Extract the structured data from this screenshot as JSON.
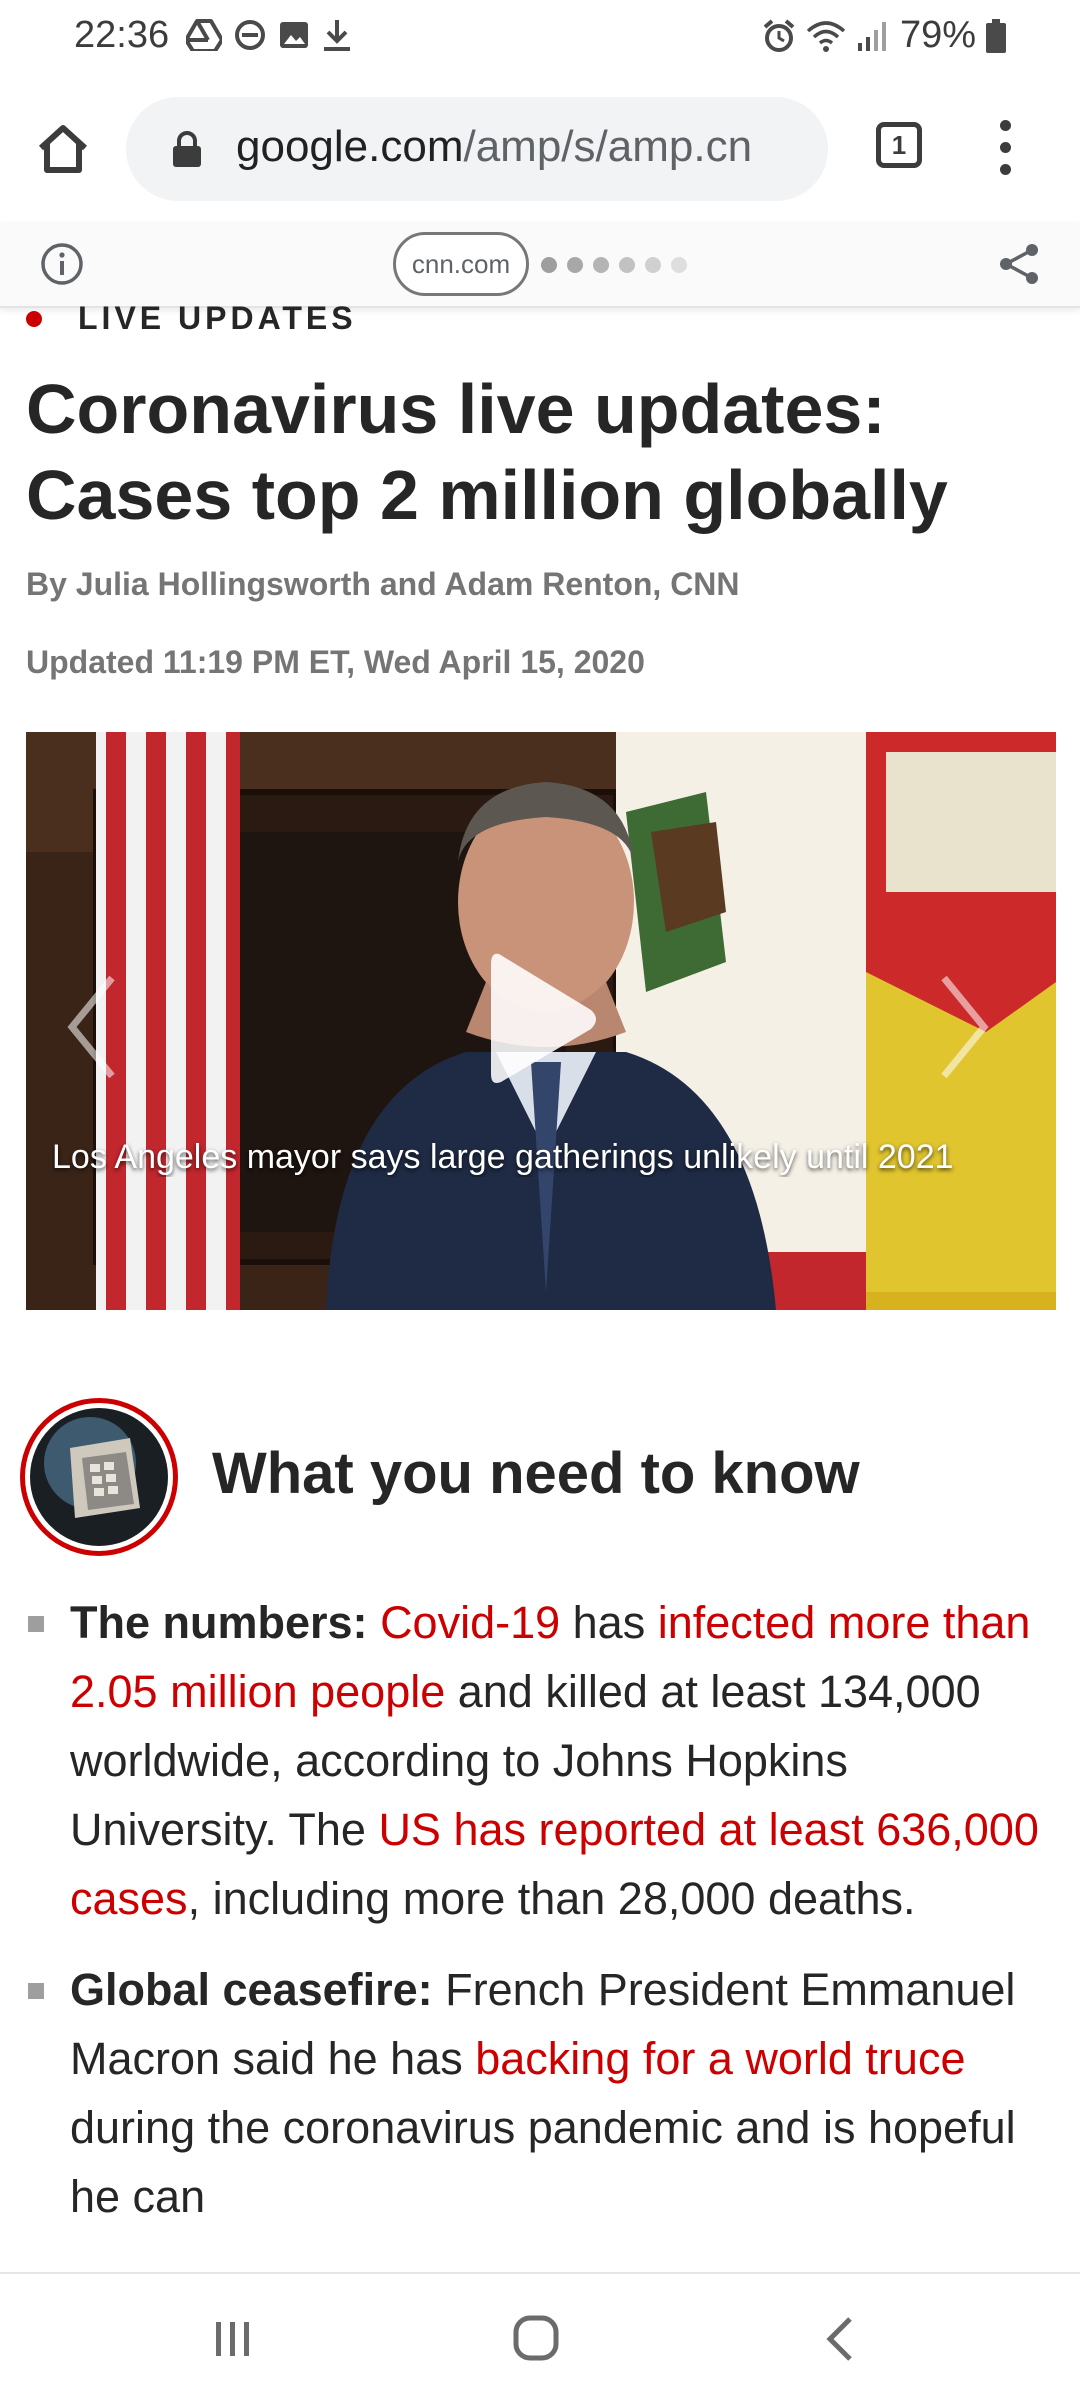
{
  "status_bar": {
    "time": "22:36",
    "left_icons": [
      "drive-icon",
      "do-not-disturb-icon",
      "gallery-icon",
      "download-icon"
    ],
    "right_icons": [
      "alarm-icon",
      "wifi-icon",
      "signal-icon"
    ],
    "battery_text": "79%"
  },
  "browser": {
    "url_domain": "google.com",
    "url_path": "/amp/s/amp.cn",
    "tab_count": "1"
  },
  "amp_header": {
    "source": "cnn.com"
  },
  "article": {
    "live_label": "LIVE UPDATES",
    "headline": "Coronavirus live updates: Cases top 2 million globally",
    "byline": "By Julia Hollingsworth and Adam Renton, CNN",
    "updated": "Updated 11:19 PM ET, Wed April 15, 2020",
    "video_caption": "Los Angeles mayor says large gatherings unlikely until 2021"
  },
  "section": {
    "title": "What you need to know"
  },
  "bullets": [
    {
      "label": "The numbers:",
      "parts": [
        {
          "text": " ",
          "link": false
        },
        {
          "text": "Covid-19",
          "link": true
        },
        {
          "text": " has ",
          "link": false
        },
        {
          "text": "infected more than 2.05 million people",
          "link": true
        },
        {
          "text": " and killed at least 134,000 worldwide, according to Johns Hopkins University. The ",
          "link": false
        },
        {
          "text": "US has reported at least 636,000 cases",
          "link": true
        },
        {
          "text": ", including more than 28,000 deaths.",
          "link": false
        }
      ]
    },
    {
      "label": "Global ceasefire:",
      "parts": [
        {
          "text": " French President Emmanuel Macron said he has ",
          "link": false
        },
        {
          "text": "backing for a world truce",
          "link": true
        },
        {
          "text": " during the coronavirus pandemic and is hopeful he can",
          "link": false
        }
      ]
    }
  ],
  "colors": {
    "accent": "#cc0000",
    "text": "#262626",
    "muted": "#757575"
  }
}
